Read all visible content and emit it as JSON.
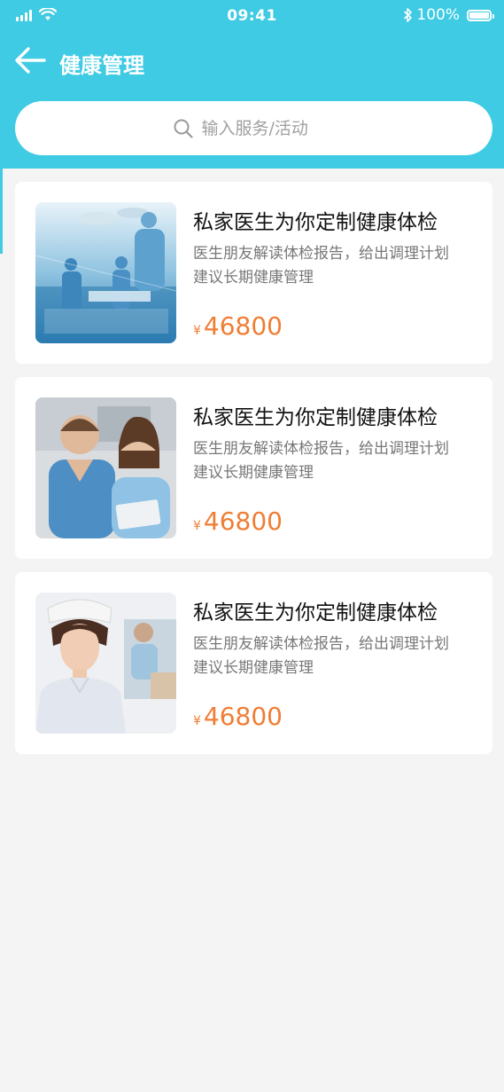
{
  "status_bar": {
    "time": "09:41",
    "battery": "100%"
  },
  "nav": {
    "title": "健康管理"
  },
  "search": {
    "placeholder": "输入服务/活动"
  },
  "colors": {
    "primary": "#3ecbe3",
    "price": "#f07d34",
    "background": "#f4f4f4"
  },
  "cards": [
    {
      "title": "私家医生为你定制健康体检",
      "desc_line1": "医生朋友解读体检报告，给出调理计划",
      "desc_line2": "建议长期健康管理",
      "currency": "¥",
      "price": "46800",
      "image": "surgery-team-photo"
    },
    {
      "title": "私家医生为你定制健康体检",
      "desc_line1": "医生朋友解读体检报告，给出调理计划",
      "desc_line2": "建议长期健康管理",
      "currency": "¥",
      "price": "46800",
      "image": "doctor-pair-photo"
    },
    {
      "title": "私家医生为你定制健康体检",
      "desc_line1": "医生朋友解读体检报告，给出调理计划",
      "desc_line2": "建议长期健康管理",
      "currency": "¥",
      "price": "46800",
      "image": "nurse-photo"
    }
  ]
}
